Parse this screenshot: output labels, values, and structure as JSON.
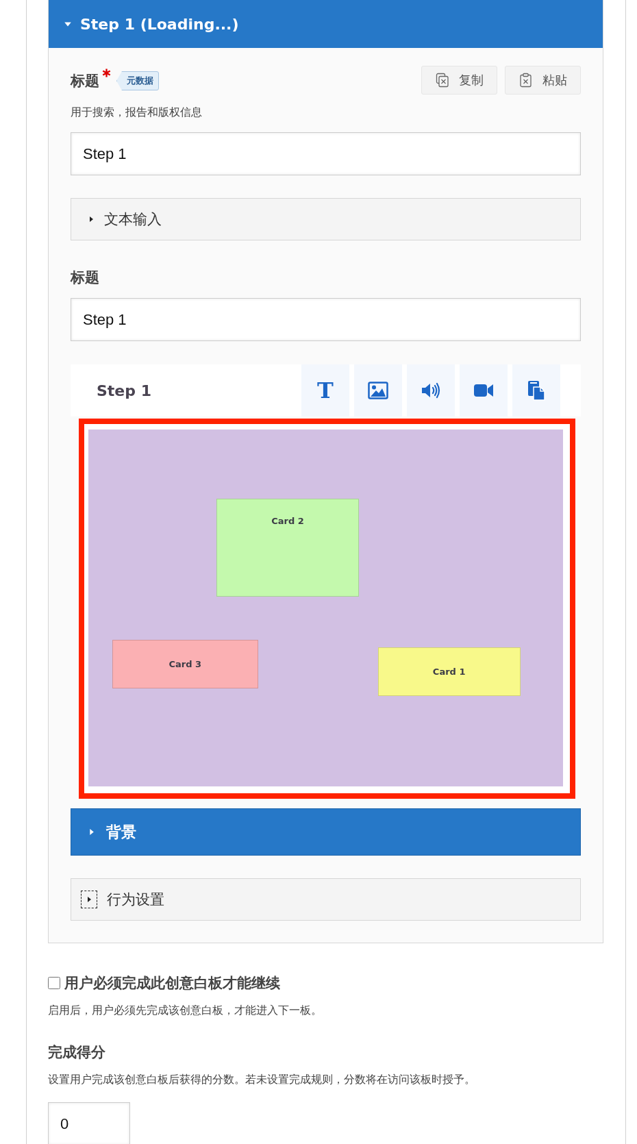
{
  "step_panel": {
    "title": "Step 1 (Loading...)",
    "expanded": true,
    "title_field": {
      "label": "标题",
      "required": true,
      "tag": "元数据",
      "hint": "用于搜索，报告和版权信息",
      "value": "Step 1"
    },
    "copy_buttons": [
      {
        "kind": "copy",
        "label": "复制"
      },
      {
        "kind": "paste",
        "label": "粘贴"
      }
    ],
    "text_input_section": {
      "label": "文本输入",
      "expanded": false
    },
    "heading_field": {
      "label": "标题",
      "value": "Step 1"
    },
    "editor": {
      "title": "Step 1",
      "tools": [
        {
          "kind": "text",
          "glyph": "T"
        },
        {
          "kind": "image"
        },
        {
          "kind": "audio"
        },
        {
          "kind": "video"
        },
        {
          "kind": "paste"
        }
      ],
      "cards": [
        {
          "label": "Card 2",
          "color": "#c4f9ad"
        },
        {
          "label": "Card 3",
          "color": "#fbb0b3"
        },
        {
          "label": "Card 1",
          "color": "#f8f98a"
        }
      ]
    },
    "background_section": {
      "label": "背景",
      "expanded": false
    },
    "behaviour_section": {
      "label": "行为设置",
      "expanded": false,
      "focused": true
    }
  },
  "require_completion": {
    "label": "用户必须完成此创意白板才能继续",
    "checked": false,
    "hint": "启用后，用户必须先完成该创意白板，才能进入下一板。"
  },
  "score": {
    "label": "完成得分",
    "hint": "设置用户完成该创意白板后获得的分数。若未设置完成规则，分数将在访问该板时授予。",
    "value": "0"
  }
}
